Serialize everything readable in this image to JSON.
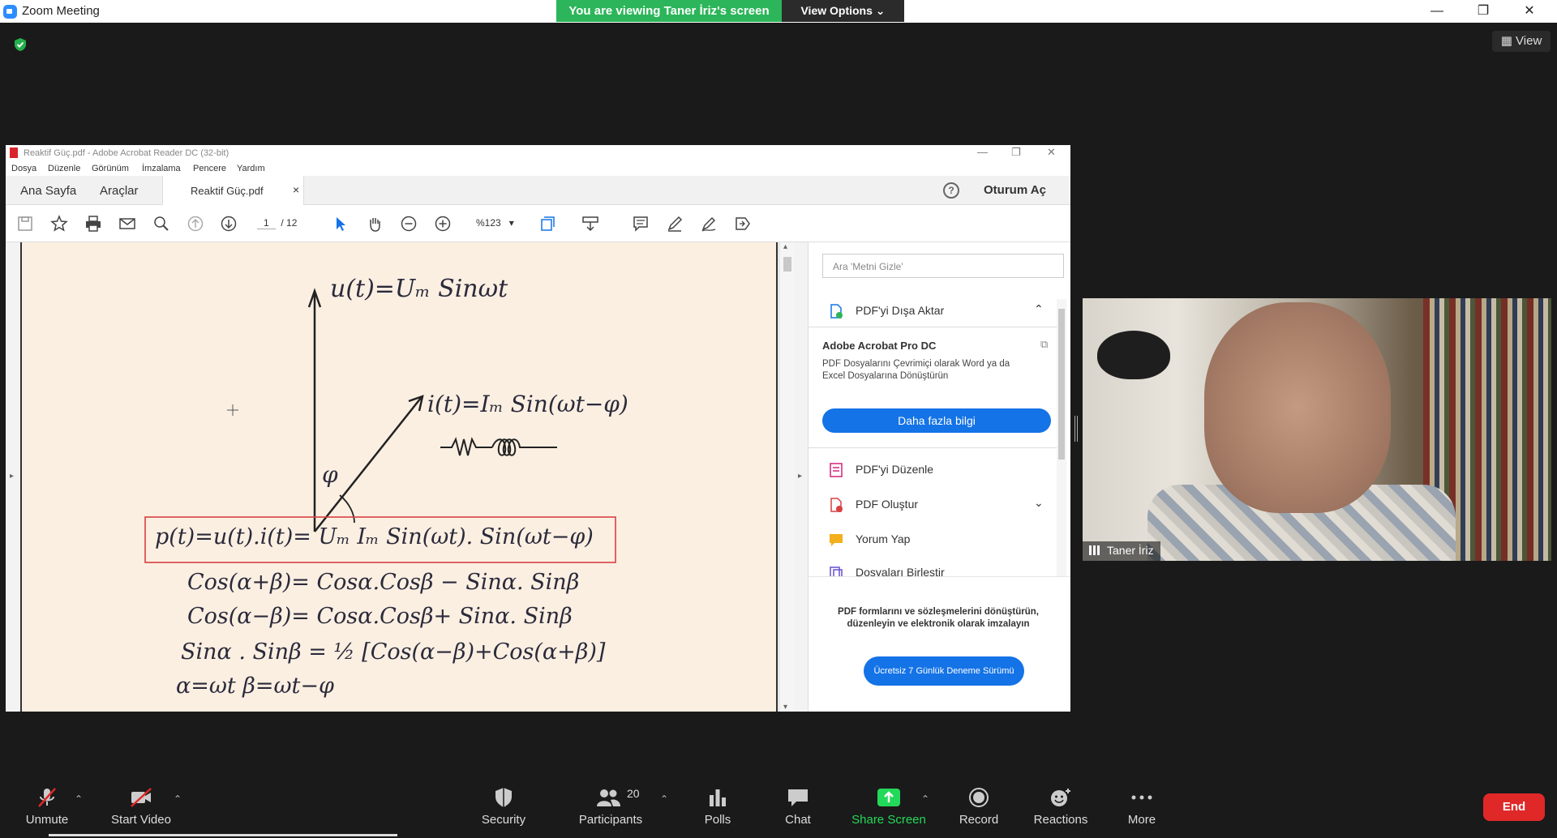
{
  "zoom": {
    "window_title": "Zoom Meeting",
    "viewing_banner": "You are viewing Taner İriz's screen",
    "view_options": "View Options ⌄",
    "view_button": "View",
    "win_minimize": "—",
    "win_restore": "❐",
    "win_close": "✕"
  },
  "acrobat": {
    "title": "Reaktif Güç.pdf - Adobe Acrobat Reader DC (32-bit)",
    "menu": [
      "Dosya",
      "Düzenle",
      "Görünüm",
      "İmzalama",
      "Pencere",
      "Yardım"
    ],
    "tabs": {
      "home": "Ana Sayfa",
      "tools": "Araçlar",
      "doc": "Reaktif Güç.pdf",
      "close": "×"
    },
    "sign_in": "Oturum Aç",
    "help": "?",
    "page_current": "1",
    "page_total": "/ 12",
    "zoom_level": "%123",
    "document_lines": {
      "u": "u(t)=Uₘ Sinωt",
      "i": "i(t)=Iₘ Sin(ωt−φ)",
      "phi": "φ",
      "p": "p(t)=u(t).i(t)= Uₘ Iₘ Sin(ωt). Sin(ωt−φ)",
      "cos_sum": "Cos(α+β)= Cosα.Cosβ − Sinα. Sinβ",
      "cos_diff": "Cos(α−β)= Cosα.Cosβ+ Sinα. Sinβ",
      "sin_prod": "Sinα . Sinβ = ½ [Cos(α−β)+Cos(α+β)]",
      "alpha_beta": "α=ωt     β=ωt−φ"
    },
    "panel": {
      "search_placeholder": "Ara 'Metni Gizle'",
      "export_label": "PDF'yi Dışa Aktar",
      "promo_title": "Adobe Acrobat Pro DC",
      "promo_text": "PDF Dosyalarını Çevrimiçi olarak Word ya da Excel Dosyalarına Dönüştürün",
      "promo_button": "Daha fazla bilgi",
      "items": [
        "PDF'yi Düzenle",
        "PDF Oluştur",
        "Yorum Yap",
        "Dosyaları Birleştir"
      ],
      "bottom_text": "PDF formlarını ve sözleşmelerini dönüştürün, düzenleyin ve elektronik olarak imzalayın",
      "bottom_button": "Ücretsiz 7 Günlük Deneme Sürümü"
    }
  },
  "video": {
    "participant_name": "Taner İriz"
  },
  "toolbar": {
    "unmute": "Unmute",
    "start_video": "Start Video",
    "security": "Security",
    "participants": "Participants",
    "participants_count": "20",
    "polls": "Polls",
    "chat": "Chat",
    "share_screen": "Share Screen",
    "record": "Record",
    "reactions": "Reactions",
    "more": "More",
    "end": "End"
  },
  "colors": {
    "banner_green": "#2cb55a",
    "share_green": "#23d959",
    "end_red": "#e02828",
    "acrobat_blue": "#1473e6"
  }
}
